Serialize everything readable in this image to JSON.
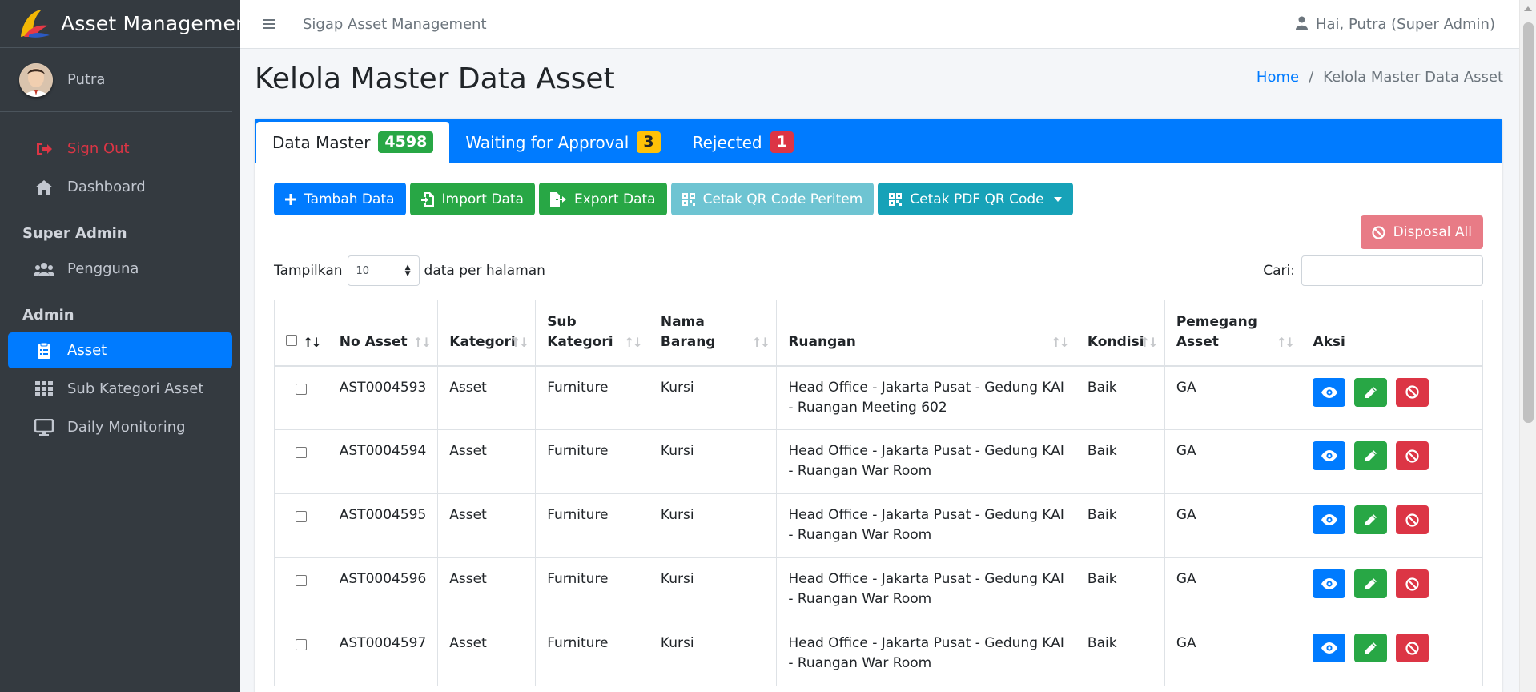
{
  "brand": {
    "name": "Asset Management"
  },
  "sidebar": {
    "user_name": "Putra",
    "items_top": [
      {
        "label": "Sign Out",
        "icon": "sign-out-icon"
      },
      {
        "label": "Dashboard",
        "icon": "home-icon"
      }
    ],
    "header_super_admin": "Super Admin",
    "item_pengguna": "Pengguna",
    "header_admin": "Admin",
    "item_asset": "Asset",
    "item_sub_kategori": "Sub Kategori Asset",
    "item_daily_monitoring": "Daily Monitoring"
  },
  "topbar": {
    "title": "Sigap Asset Management",
    "user_greeting": "Hai, Putra (Super Admin)"
  },
  "page": {
    "title": "Kelola Master Data Asset",
    "breadcrumb_home": "Home",
    "breadcrumb_sep": "/",
    "breadcrumb_current": "Kelola Master Data Asset"
  },
  "tabs": [
    {
      "label": "Data Master",
      "badge": "4598"
    },
    {
      "label": "Waiting for Approval",
      "badge": "3"
    },
    {
      "label": "Rejected",
      "badge": "1"
    }
  ],
  "toolbar": {
    "tambah": "Tambah Data",
    "import": "Import Data",
    "export": "Export Data",
    "cetak_qr": "Cetak QR Code Peritem",
    "cetak_pdf": "Cetak PDF QR Code",
    "disposal_all": "Disposal All"
  },
  "table_controls": {
    "tampilkan": "Tampilkan",
    "page_size": "10",
    "per_page": "data per halaman",
    "search_label": "Cari:",
    "search_value": ""
  },
  "table": {
    "headers": {
      "no_asset": "No Asset",
      "kategori": "Kategori",
      "sub_kategori_1": "Sub",
      "sub_kategori_2": "Kategori",
      "nama_barang_1": "Nama",
      "nama_barang_2": "Barang",
      "ruangan": "Ruangan",
      "kondisi": "Kondisi",
      "pemegang_1": "Pemegang",
      "pemegang_2": "Asset",
      "aksi": "Aksi"
    },
    "rows": [
      {
        "no_asset": "AST0004593",
        "kategori": "Asset",
        "sub_kategori": "Furniture",
        "nama_barang": "Kursi",
        "ruangan": "Head Office - Jakarta Pusat - Gedung KAI - Ruangan Meeting 602",
        "kondisi": "Baik",
        "pemegang": "GA"
      },
      {
        "no_asset": "AST0004594",
        "kategori": "Asset",
        "sub_kategori": "Furniture",
        "nama_barang": "Kursi",
        "ruangan": "Head Office - Jakarta Pusat - Gedung KAI - Ruangan War Room",
        "kondisi": "Baik",
        "pemegang": "GA"
      },
      {
        "no_asset": "AST0004595",
        "kategori": "Asset",
        "sub_kategori": "Furniture",
        "nama_barang": "Kursi",
        "ruangan": "Head Office - Jakarta Pusat - Gedung KAI - Ruangan War Room",
        "kondisi": "Baik",
        "pemegang": "GA"
      },
      {
        "no_asset": "AST0004596",
        "kategori": "Asset",
        "sub_kategori": "Furniture",
        "nama_barang": "Kursi",
        "ruangan": "Head Office - Jakarta Pusat - Gedung KAI - Ruangan War Room",
        "kondisi": "Baik",
        "pemegang": "GA"
      },
      {
        "no_asset": "AST0004597",
        "kategori": "Asset",
        "sub_kategori": "Furniture",
        "nama_barang": "Kursi",
        "ruangan": "Head Office - Jakarta Pusat - Gedung KAI - Ruangan War Room",
        "kondisi": "Baik",
        "pemegang": "GA"
      }
    ]
  },
  "colors": {
    "sidebar_bg": "#343a40",
    "primary": "#007bff",
    "success": "#28a745",
    "danger": "#dc3545",
    "info": "#17a2b8",
    "warning": "#ffc107"
  }
}
